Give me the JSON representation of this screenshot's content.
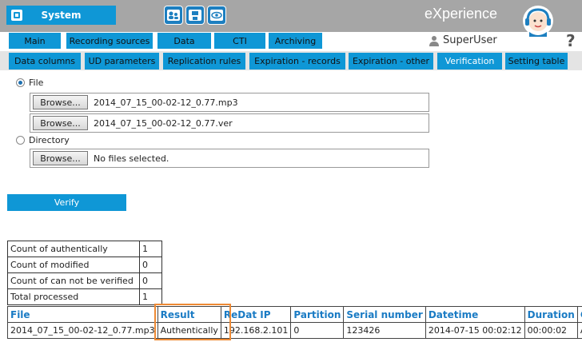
{
  "header": {
    "system_label": "System",
    "brand": "eXperience",
    "toolbar_icons": [
      "users-icon",
      "save-icon",
      "eye-icon"
    ],
    "user_name": "SuperUser",
    "help": "?"
  },
  "nav_main": [
    "Main",
    "Recording sources",
    "Data",
    "CTI",
    "Archiving"
  ],
  "nav_sub": [
    "Data columns",
    "UD parameters",
    "Replication rules",
    "Expiration - records",
    "Expiration - other",
    "Verification",
    "Setting table"
  ],
  "nav_sub_active": "Verification",
  "form": {
    "file_label": "File",
    "directory_label": "Directory",
    "browse_label": "Browse...",
    "file1": "2014_07_15_00-02-12_0.77.mp3",
    "file2": "2014_07_15_00-02-12_0.77.ver",
    "dir_value": "No files selected.",
    "verify_label": "Verify"
  },
  "stats": [
    {
      "label": "Count of authentically",
      "value": "1"
    },
    {
      "label": "Count of modified",
      "value": "0"
    },
    {
      "label": "Count of can not be verified",
      "value": "0"
    },
    {
      "label": "Total processed",
      "value": "1"
    }
  ],
  "results": {
    "columns": [
      "File",
      "Result",
      "ReDat IP",
      "Partition",
      "Serial number",
      "Datetime",
      "Duration",
      "C"
    ],
    "row": [
      "2014_07_15_00-02-12_0.77.mp3",
      "Authentically",
      "192.168.2.101",
      "0",
      "123426",
      "2014-07-15 00:02:12",
      "00:00:02",
      "A"
    ]
  },
  "colors": {
    "accent": "#0f97d6",
    "topbar": "#a6a6a6",
    "highlight": "#ee8a35"
  }
}
